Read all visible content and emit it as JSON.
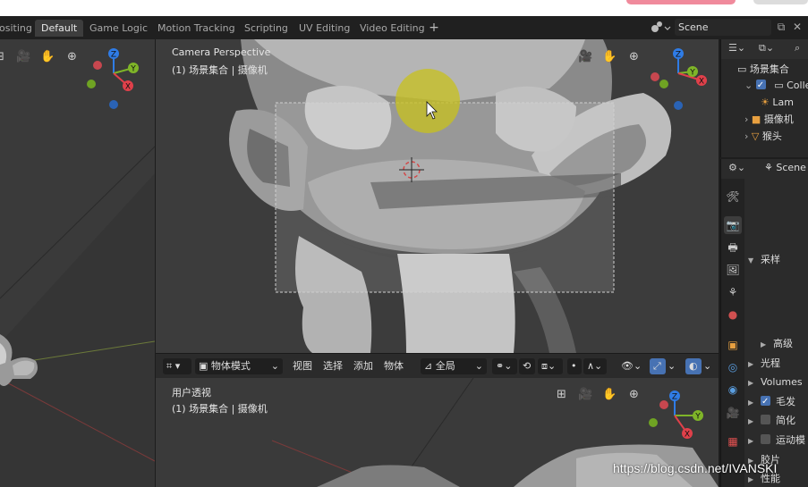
{
  "workspace_tabs": [
    {
      "label": "ositing",
      "active": false
    },
    {
      "label": "Default",
      "active": true
    },
    {
      "label": "Game Logic",
      "active": false
    },
    {
      "label": "Motion Tracking",
      "active": false
    },
    {
      "label": "Scripting",
      "active": false
    },
    {
      "label": "UV Editing",
      "active": false
    },
    {
      "label": "Video Editing",
      "active": false
    }
  ],
  "add_tab": "+",
  "scene": {
    "name": "Scene",
    "copy_icon": "copy-icon",
    "close_icon": "close-icon"
  },
  "top_viewport": {
    "title": "Camera Perspective",
    "subtitle": "(1) 场景集合 | 摄像机"
  },
  "bottom_viewport": {
    "title": "用户透视",
    "subtitle": "(1) 场景集合 | 摄像机"
  },
  "gizmo_labels": {
    "z": "Z",
    "y": "Y",
    "x": "X"
  },
  "header": {
    "mode": "物体模式",
    "menus": [
      "视图",
      "选择",
      "添加",
      "物体"
    ],
    "transform_orientation": "全局"
  },
  "outliner": {
    "root": "场景集合",
    "items": [
      {
        "label": "Colle",
        "icon": "collection-icon",
        "checked": true
      },
      {
        "label": "Lam",
        "icon": "light-icon"
      },
      {
        "label": "摄像机",
        "icon": "camera-icon"
      },
      {
        "label": "猴头",
        "icon": "cone-icon"
      }
    ]
  },
  "properties": {
    "scene_label": "Scene",
    "sections": {
      "sampling": "采样",
      "advanced": "高级",
      "light_paths": "光程",
      "volumes": "Volumes",
      "hair": "毛发",
      "simplify": "简化",
      "motion_blur": "运动模",
      "film": "胶片",
      "performance": "性能"
    },
    "hair_checked": true,
    "simplify_checked": false,
    "motion_blur_checked": false
  },
  "watermark": "https://blog.csdn.net/IVANSKI",
  "colors": {
    "accent_blue": "#4772b3",
    "axis_x": "#e0404a",
    "axis_y": "#7fb528",
    "axis_z": "#2f7ce6"
  }
}
